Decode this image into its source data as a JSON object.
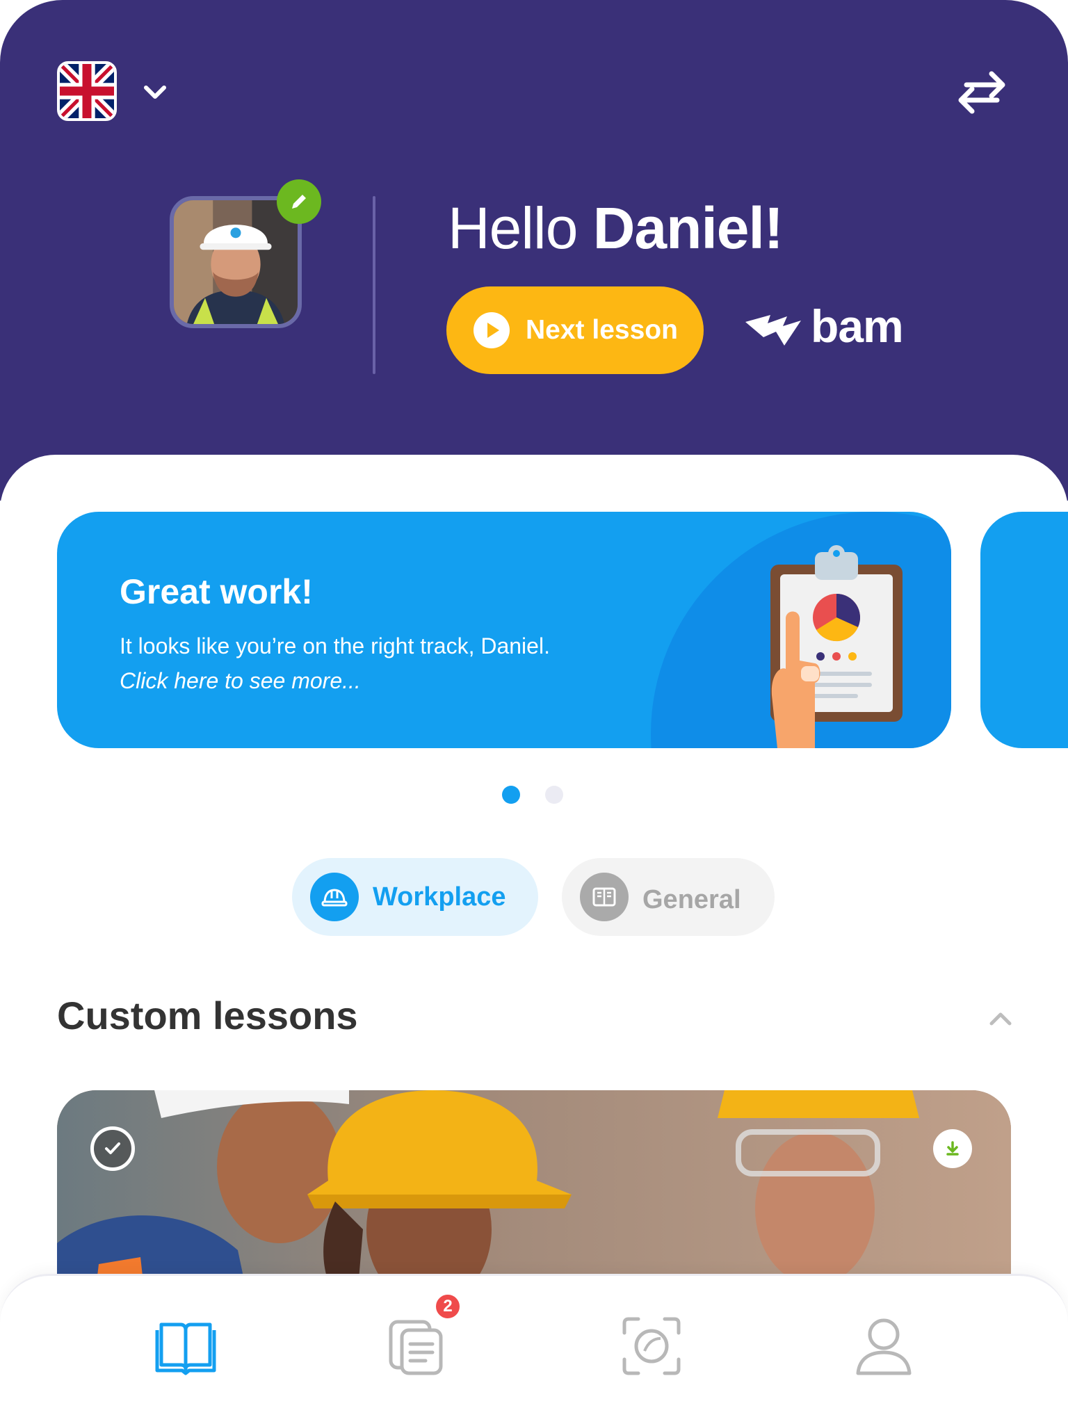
{
  "header": {
    "language": "English (UK)",
    "greeting_prefix": "Hello ",
    "user_name": "Daniel!",
    "next_lesson_label": "Next lesson",
    "brand_text": "bam"
  },
  "banner": {
    "title": "Great work!",
    "text": "It looks like you’re on the right track, Daniel. ",
    "link_text": "Click here to see more..."
  },
  "carousel": {
    "page_count": 2,
    "active_index": 0
  },
  "tabs": [
    {
      "label": "Workplace",
      "icon": "hard-hat-icon",
      "active": true
    },
    {
      "label": "General",
      "icon": "book-icon",
      "active": false
    }
  ],
  "section": {
    "title": "Custom lessons",
    "collapsed": false
  },
  "lesson_card": {
    "completed": true,
    "downloadable": true
  },
  "bottom_nav": {
    "items": [
      {
        "icon": "lessons-book-icon",
        "active": true
      },
      {
        "icon": "notes-icon",
        "badge": "2"
      },
      {
        "icon": "scan-icon"
      },
      {
        "icon": "profile-icon"
      }
    ]
  },
  "colors": {
    "header_bg": "#3a3078",
    "accent_blue": "#139ff0",
    "cta_yellow": "#fdb713",
    "edit_green": "#6cb820",
    "badge_red": "#ef4b4b"
  }
}
